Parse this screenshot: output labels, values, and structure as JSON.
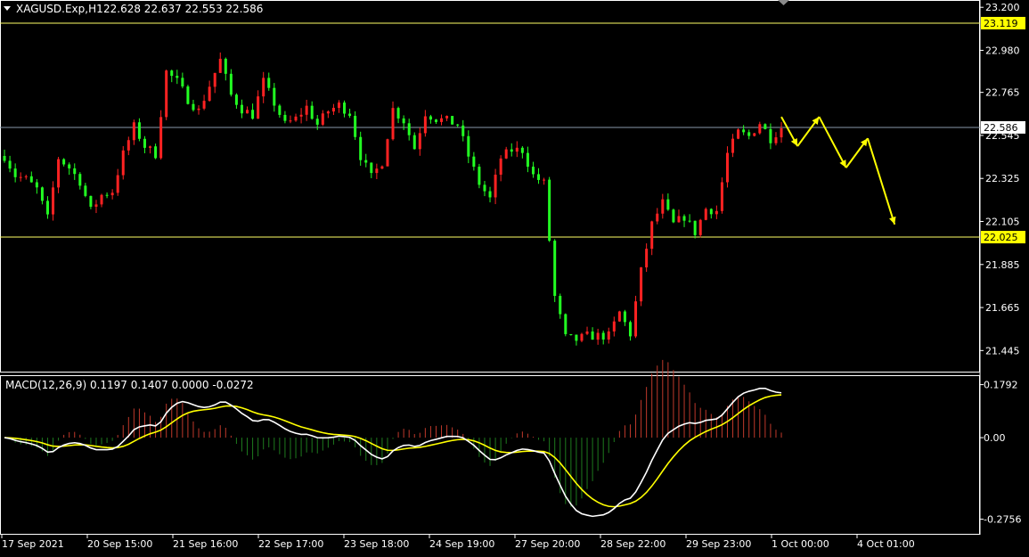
{
  "header": {
    "symbol": "XAGUSD.Exp,H1",
    "ohlc": "22.628 22.637 22.553 22.586"
  },
  "macd": {
    "label": "MACD(12,26,9) 0.1197 0.1407 0.0000 -0.0272"
  },
  "colors": {
    "background": "#000000",
    "bull": "#ff2222",
    "bear": "#22ff22",
    "macd_line": "#ffffff",
    "signal_line": "#ffff00",
    "level_line": "#ffff66",
    "bid_line": "#8899aa",
    "price_label_bg": "#ffff00",
    "text": "#ffffff"
  },
  "chart_data": {
    "type": "candlestick",
    "price_ticks": [
      "23.200",
      "22.980",
      "22.765",
      "22.545",
      "22.325",
      "22.105",
      "21.885",
      "21.665",
      "21.445"
    ],
    "levels": [
      {
        "name": "resistance",
        "price": 23.119,
        "label": "23.119"
      },
      {
        "name": "support",
        "price": 22.025,
        "label": "22.025"
      }
    ],
    "current_price": {
      "price": 22.586,
      "label": "22.586"
    },
    "price_range": [
      21.36,
      23.21
    ],
    "price_path": [
      [
        0,
        22.44
      ],
      [
        2,
        22.34
      ],
      [
        4,
        22.32
      ],
      [
        6,
        22.27
      ],
      [
        8,
        22.12
      ],
      [
        10,
        22.43
      ],
      [
        12,
        22.38
      ],
      [
        14,
        22.31
      ],
      [
        16,
        22.16
      ],
      [
        18,
        22.24
      ],
      [
        20,
        22.26
      ],
      [
        22,
        22.45
      ],
      [
        24,
        22.59
      ],
      [
        26,
        22.49
      ],
      [
        28,
        22.45
      ],
      [
        30,
        22.87
      ],
      [
        32,
        22.82
      ],
      [
        34,
        22.73
      ],
      [
        36,
        22.67
      ],
      [
        38,
        22.8
      ],
      [
        40,
        22.93
      ],
      [
        42,
        22.75
      ],
      [
        44,
        22.68
      ],
      [
        46,
        22.65
      ],
      [
        48,
        22.82
      ],
      [
        50,
        22.71
      ],
      [
        52,
        22.6
      ],
      [
        54,
        22.63
      ],
      [
        56,
        22.69
      ],
      [
        58,
        22.6
      ],
      [
        60,
        22.67
      ],
      [
        62,
        22.7
      ],
      [
        64,
        22.66
      ],
      [
        66,
        22.44
      ],
      [
        68,
        22.33
      ],
      [
        70,
        22.41
      ],
      [
        72,
        22.68
      ],
      [
        74,
        22.62
      ],
      [
        76,
        22.48
      ],
      [
        78,
        22.66
      ],
      [
        80,
        22.63
      ],
      [
        82,
        22.62
      ],
      [
        84,
        22.6
      ],
      [
        86,
        22.44
      ],
      [
        88,
        22.3
      ],
      [
        90,
        22.22
      ],
      [
        92,
        22.43
      ],
      [
        94,
        22.47
      ],
      [
        96,
        22.47
      ],
      [
        98,
        22.34
      ],
      [
        100,
        22.3
      ],
      [
        102,
        21.72
      ],
      [
        104,
        21.51
      ],
      [
        106,
        21.5
      ],
      [
        108,
        21.52
      ],
      [
        110,
        21.52
      ],
      [
        112,
        21.52
      ],
      [
        114,
        21.64
      ],
      [
        116,
        21.53
      ],
      [
        118,
        21.85
      ],
      [
        120,
        22.09
      ],
      [
        122,
        22.2
      ],
      [
        124,
        22.09
      ],
      [
        126,
        22.13
      ],
      [
        128,
        22.05
      ],
      [
        130,
        22.17
      ],
      [
        132,
        22.16
      ],
      [
        134,
        22.45
      ],
      [
        136,
        22.56
      ],
      [
        138,
        22.54
      ],
      [
        140,
        22.61
      ],
      [
        142,
        22.53
      ],
      [
        144,
        22.586
      ]
    ],
    "forecast_arrow_path": [
      [
        144,
        22.64
      ],
      [
        147,
        22.49
      ],
      [
        151,
        22.64
      ],
      [
        156,
        22.38
      ],
      [
        160,
        22.53
      ],
      [
        165,
        22.09
      ]
    ],
    "macd_ticks": [
      "0.1792",
      "0.00",
      "-0.2756"
    ],
    "macd_range": [
      -0.31,
      0.19
    ],
    "time_labels": [
      "17 Sep 2021",
      "20 Sep 15:00",
      "21 Sep 16:00",
      "22 Sep 17:00",
      "23 Sep 18:00",
      "24 Sep 19:00",
      "27 Sep 20:00",
      "28 Sep 22:00",
      "29 Sep 23:00",
      "1 Oct 00:00",
      "4 Oct 01:00"
    ]
  }
}
